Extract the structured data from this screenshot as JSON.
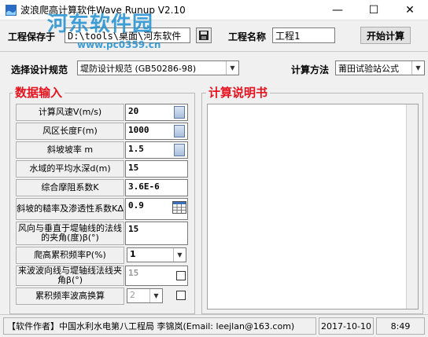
{
  "window": {
    "title": "波浪爬高计算软件Wave Runup V2.10",
    "minimize": "—",
    "maximize": "☐",
    "close": "✕"
  },
  "toolbar": {
    "save_path_label": "工程保存于",
    "save_path_value": "D:\\tools\\桌面\\河东软件",
    "project_name_label": "工程名称",
    "project_name_value": "工程1",
    "start_button": "开始计算"
  },
  "settings": {
    "spec_label": "选择设计规范",
    "spec_value": "堤防设计规范 (GB50286-98)",
    "method_label": "计算方法",
    "method_value": "莆田试验站公式"
  },
  "data_input": {
    "title": "数据输入",
    "rows": [
      {
        "label": "计算风速V(m/s)",
        "value": "20"
      },
      {
        "label": "风区长度F(m)",
        "value": "1000"
      },
      {
        "label": "斜坡坡率 m",
        "value": "1.5"
      },
      {
        "label": "水域的平均水深d(m)",
        "value": "15"
      },
      {
        "label": "综合摩阻系数K",
        "value": "3.6E-6"
      },
      {
        "label": "斜坡的糙率及渗透性系数KΔ",
        "value": "0.9"
      },
      {
        "label": "风向与垂直于堤轴线的法线的夹角(度)β(°)",
        "value": "15"
      },
      {
        "label": "爬高累积频率P(%)",
        "value": "1"
      },
      {
        "label": "来波波向线与堤轴线法线夹角β(°)",
        "value": "15"
      },
      {
        "label": "累积频率波高换算",
        "value": "2"
      }
    ]
  },
  "report": {
    "title": "计算说明书"
  },
  "status": {
    "author": "【软件作者】中国水利水电第八工程局 李锦岚(Email: leejlan@163.com)",
    "date": "2017-10-10",
    "time": "8:49"
  },
  "watermark": {
    "brand": "河东软件园",
    "url": "www.pc0359.cn"
  },
  "colors": {
    "group_title": "#e8121e",
    "watermark": "#1f8fd1"
  }
}
